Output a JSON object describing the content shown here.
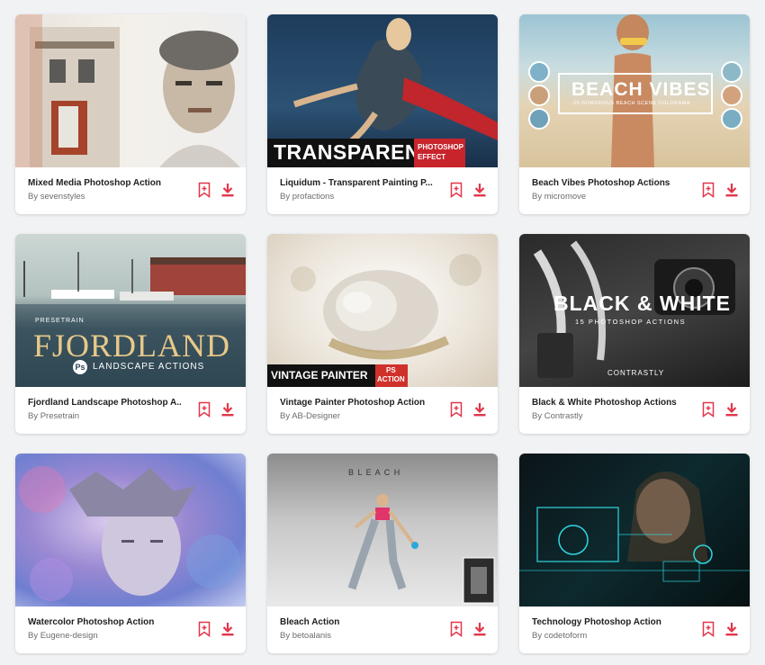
{
  "accent_color": "#e2364a",
  "cards": [
    {
      "title": "Mixed Media Photoshop Action",
      "author": "By sevenstyles"
    },
    {
      "title": "Liquidum - Transparent Painting P...",
      "author": "By profactions"
    },
    {
      "title": "Beach Vibes Photoshop Actions",
      "author": "By micromove"
    },
    {
      "title": "Fjordland Landscape Photoshop A...",
      "author": "By Presetrain"
    },
    {
      "title": "Vintage Painter Photoshop Action",
      "author": "By AB-Designer"
    },
    {
      "title": "Black & White Photoshop Actions",
      "author": "By Contrastly"
    },
    {
      "title": "Watercolor Photoshop Action",
      "author": "By Eugene-design"
    },
    {
      "title": "Bleach Action",
      "author": "By betoalanis"
    },
    {
      "title": "Technology Photoshop Action",
      "author": "By codetoform"
    }
  ],
  "thumbs": {
    "transparent_main": "TRANSPARENT",
    "transparent_badge_1": "PHOTOSHOP",
    "transparent_badge_2": "EFFECT",
    "beach_title": "BEACH VIBES",
    "beach_sub": "25 GORGEOUS BEACH SCENE COLORAMA",
    "fjord_brand": "PRESETRAIN",
    "fjord_title": "FJORDLAND",
    "fjord_ps": "Ps",
    "fjord_sub": "LANDSCAPE ACTIONS",
    "vintage_title": "VINTAGE PAINTER",
    "vintage_badge_1": "PS",
    "vintage_badge_2": "ACTION",
    "bw_title": "BLACK & WHITE",
    "bw_sub": "15 PHOTOSHOP ACTIONS",
    "bw_brand": "CONTRASTLY",
    "bleach_title": "B L E A C H"
  }
}
